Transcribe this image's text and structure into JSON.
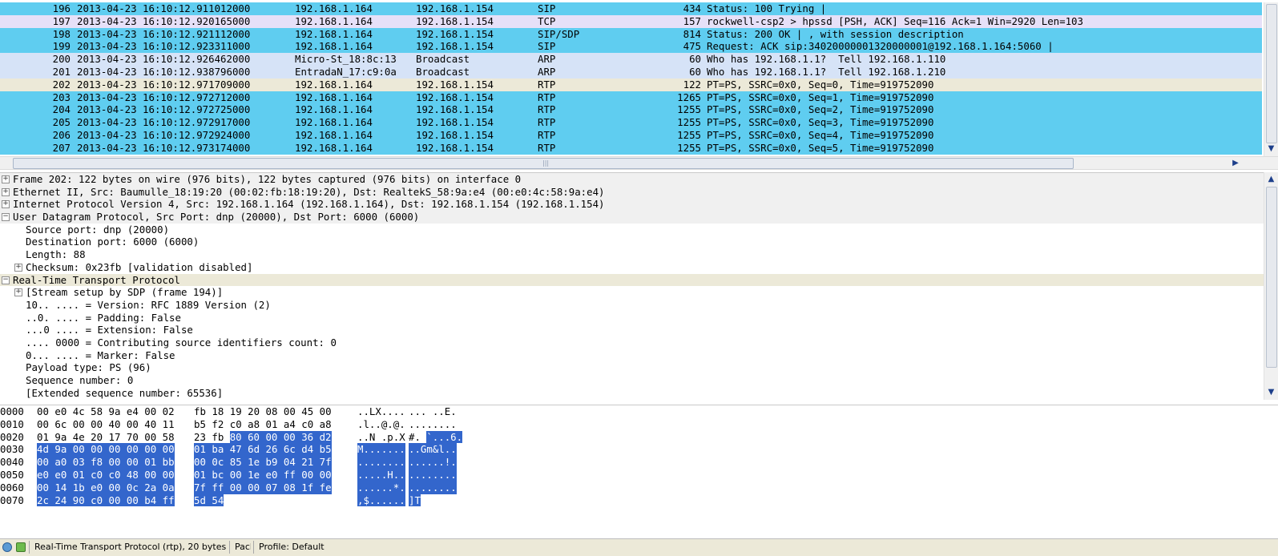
{
  "colors": {
    "sip": "#5fcdf0",
    "tcp": "#e3dff5",
    "arp": "#d8e4f5",
    "rtp_selected": "#ece9d8",
    "rtp": "#5fcdf0",
    "selection": "#3366cc"
  },
  "packets": [
    {
      "no": "196",
      "time": "2013-04-23 16:10:12.911012000",
      "src": "192.168.1.164",
      "dst": "192.168.1.154",
      "proto": "SIP",
      "len": "434",
      "info": "Status: 100 Trying |",
      "color": "#5fcdf0"
    },
    {
      "no": "197",
      "time": "2013-04-23 16:10:12.920165000",
      "src": "192.168.1.164",
      "dst": "192.168.1.154",
      "proto": "TCP",
      "len": "157",
      "info": "rockwell-csp2 > hpssd [PSH, ACK] Seq=116 Ack=1 Win=2920 Len=103",
      "color": "#e6e0f8"
    },
    {
      "no": "198",
      "time": "2013-04-23 16:10:12.921112000",
      "src": "192.168.1.164",
      "dst": "192.168.1.154",
      "proto": "SIP/SDP",
      "len": "814",
      "info": "Status: 200 OK | , with session description",
      "color": "#5fcdf0"
    },
    {
      "no": "199",
      "time": "2013-04-23 16:10:12.923311000",
      "src": "192.168.1.164",
      "dst": "192.168.1.154",
      "proto": "SIP",
      "len": "475",
      "info": "Request: ACK sip:34020000001320000001@192.168.1.164:5060 |",
      "color": "#5fcdf0"
    },
    {
      "no": "200",
      "time": "2013-04-23 16:10:12.926462000",
      "src": "Micro-St_18:8c:13",
      "dst": "Broadcast",
      "proto": "ARP",
      "len": "60",
      "info": "Who has 192.168.1.1?  Tell 192.168.1.110",
      "color": "#d6e3f7"
    },
    {
      "no": "201",
      "time": "2013-04-23 16:10:12.938796000",
      "src": "EntradaN_17:c9:0a",
      "dst": "Broadcast",
      "proto": "ARP",
      "len": "60",
      "info": "Who has 192.168.1.1?  Tell 192.168.1.210",
      "color": "#d6e3f7"
    },
    {
      "no": "202",
      "time": "2013-04-23 16:10:12.971709000",
      "src": "192.168.1.164",
      "dst": "192.168.1.154",
      "proto": "RTP",
      "len": "122",
      "info": "PT=PS, SSRC=0x0, Seq=0, Time=919752090",
      "color": "#ece9d8"
    },
    {
      "no": "203",
      "time": "2013-04-23 16:10:12.972712000",
      "src": "192.168.1.164",
      "dst": "192.168.1.154",
      "proto": "RTP",
      "len": "1265",
      "info": "PT=PS, SSRC=0x0, Seq=1, Time=919752090",
      "color": "#5fcdf0"
    },
    {
      "no": "204",
      "time": "2013-04-23 16:10:12.972725000",
      "src": "192.168.1.164",
      "dst": "192.168.1.154",
      "proto": "RTP",
      "len": "1255",
      "info": "PT=PS, SSRC=0x0, Seq=2, Time=919752090",
      "color": "#5fcdf0"
    },
    {
      "no": "205",
      "time": "2013-04-23 16:10:12.972917000",
      "src": "192.168.1.164",
      "dst": "192.168.1.154",
      "proto": "RTP",
      "len": "1255",
      "info": "PT=PS, SSRC=0x0, Seq=3, Time=919752090",
      "color": "#5fcdf0"
    },
    {
      "no": "206",
      "time": "2013-04-23 16:10:12.972924000",
      "src": "192.168.1.164",
      "dst": "192.168.1.154",
      "proto": "RTP",
      "len": "1255",
      "info": "PT=PS, SSRC=0x0, Seq=4, Time=919752090",
      "color": "#5fcdf0"
    },
    {
      "no": "207",
      "time": "2013-04-23 16:10:12.973174000",
      "src": "192.168.1.164",
      "dst": "192.168.1.154",
      "proto": "RTP",
      "len": "1255",
      "info": "PT=PS, SSRC=0x0, Seq=5, Time=919752090",
      "color": "#5fcdf0"
    }
  ],
  "details": [
    {
      "text": "Frame 202: 122 bytes on wire (976 bits), 122 bytes captured (976 bits) on interface 0",
      "indent": 0,
      "toggle": "+",
      "header": true,
      "expanded": false
    },
    {
      "text": "Ethernet II, Src: Baumulle_18:19:20 (00:02:fb:18:19:20), Dst: RealtekS_58:9a:e4 (00:e0:4c:58:9a:e4)",
      "indent": 0,
      "toggle": "+",
      "header": true,
      "expanded": false
    },
    {
      "text": "Internet Protocol Version 4, Src: 192.168.1.164 (192.168.1.164), Dst: 192.168.1.154 (192.168.1.154)",
      "indent": 0,
      "toggle": "+",
      "header": true,
      "expanded": false
    },
    {
      "text": "User Datagram Protocol, Src Port: dnp (20000), Dst Port: 6000 (6000)",
      "indent": 0,
      "toggle": "-",
      "header": true,
      "expanded": false
    },
    {
      "text": "Source port: dnp (20000)",
      "indent": 1,
      "toggle": "",
      "header": false,
      "expanded": false
    },
    {
      "text": "Destination port: 6000 (6000)",
      "indent": 1,
      "toggle": "",
      "header": false,
      "expanded": false
    },
    {
      "text": "Length: 88",
      "indent": 1,
      "toggle": "",
      "header": false,
      "expanded": false
    },
    {
      "text": "Checksum: 0x23fb [validation disabled]",
      "indent": 1,
      "toggle": "+",
      "header": false,
      "expanded": false
    },
    {
      "text": "Real-Time Transport Protocol",
      "indent": 0,
      "toggle": "-",
      "header": true,
      "expanded": true
    },
    {
      "text": "[Stream setup by SDP (frame 194)]",
      "indent": 1,
      "toggle": "+",
      "header": false,
      "expanded": false
    },
    {
      "text": "10.. .... = Version: RFC 1889 Version (2)",
      "indent": 1,
      "toggle": "",
      "header": false,
      "expanded": false
    },
    {
      "text": "..0. .... = Padding: False",
      "indent": 1,
      "toggle": "",
      "header": false,
      "expanded": false
    },
    {
      "text": "...0 .... = Extension: False",
      "indent": 1,
      "toggle": "",
      "header": false,
      "expanded": false
    },
    {
      "text": ".... 0000 = Contributing source identifiers count: 0",
      "indent": 1,
      "toggle": "",
      "header": false,
      "expanded": false
    },
    {
      "text": "0... .... = Marker: False",
      "indent": 1,
      "toggle": "",
      "header": false,
      "expanded": false
    },
    {
      "text": "Payload type: PS (96)",
      "indent": 1,
      "toggle": "",
      "header": false,
      "expanded": false
    },
    {
      "text": "Sequence number: 0",
      "indent": 1,
      "toggle": "",
      "header": false,
      "expanded": false
    },
    {
      "text": "[Extended sequence number: 65536]",
      "indent": 1,
      "toggle": "",
      "header": false,
      "expanded": false
    }
  ],
  "bytes": [
    {
      "off": "0000",
      "hexa_n": "00 e0 4c 58 9a e4 00 02",
      "hexa_h": "",
      "hexb_n": "fb 18 19 20 08 00 45 00",
      "hexb_h": "",
      "asca_n": "..LX....",
      "asca_h": "",
      "ascb_n": "... ..E.",
      "ascb_h": ""
    },
    {
      "off": "0010",
      "hexa_n": "00 6c 00 00 40 00 40 11",
      "hexa_h": "",
      "hexb_n": "b5 f2 c0 a8 01 a4 c0 a8",
      "hexb_h": "",
      "asca_n": ".l..@.@.",
      "asca_h": "",
      "ascb_n": "........",
      "ascb_h": ""
    },
    {
      "off": "0020",
      "hexa_n": "01 9a 4e 20 17 70 00 58",
      "hexa_h": "",
      "hexb_n": "23 fb",
      "hexb_h": "80 60 00 00 36 d2",
      "asca_n": "..N .p.X",
      "asca_h": "",
      "ascb_n": "#.",
      "ascb_h": "`...6."
    },
    {
      "off": "0030",
      "hexa_n": "",
      "hexa_h": "4d 9a 00 00 00 00 00 00",
      "hexb_n": "",
      "hexb_h": "01 ba 47 6d 26 6c d4 b5",
      "asca_n": "",
      "asca_h": "M.......",
      "ascb_n": "",
      "ascb_h": "..Gm&l.."
    },
    {
      "off": "0040",
      "hexa_n": "",
      "hexa_h": "00 a0 03 f8 00 00 01 bb",
      "hexb_n": "",
      "hexb_h": "00 0c 85 1e b9 04 21 7f",
      "asca_n": "",
      "asca_h": "........",
      "ascb_n": "",
      "ascb_h": "......!."
    },
    {
      "off": "0050",
      "hexa_n": "",
      "hexa_h": "e0 e0 01 c0 c0 48 00 00",
      "hexb_n": "",
      "hexb_h": "01 bc 00 1e e0 ff 00 00",
      "asca_n": "",
      "asca_h": ".....H..",
      "ascb_n": "",
      "ascb_h": "........"
    },
    {
      "off": "0060",
      "hexa_n": "",
      "hexa_h": "00 14 1b e0 00 0c 2a 0a",
      "hexb_n": "",
      "hexb_h": "7f ff 00 00 07 08 1f fe",
      "asca_n": "",
      "asca_h": "......*.",
      "ascb_n": "",
      "ascb_h": "........"
    },
    {
      "off": "0070",
      "hexa_n": "",
      "hexa_h": "2c 24 90 c0 00 00 b4 ff",
      "hexb_n": "",
      "hexb_h": "5d 54",
      "asca_n": "",
      "asca_h": ",$......",
      "ascb_n": "",
      "ascb_h": "]T"
    }
  ],
  "status": {
    "left_text": "Real-Time Transport Protocol (rtp), 20 bytes",
    "mid_text": "Packets",
    "profile_text": "Profile: Default"
  }
}
